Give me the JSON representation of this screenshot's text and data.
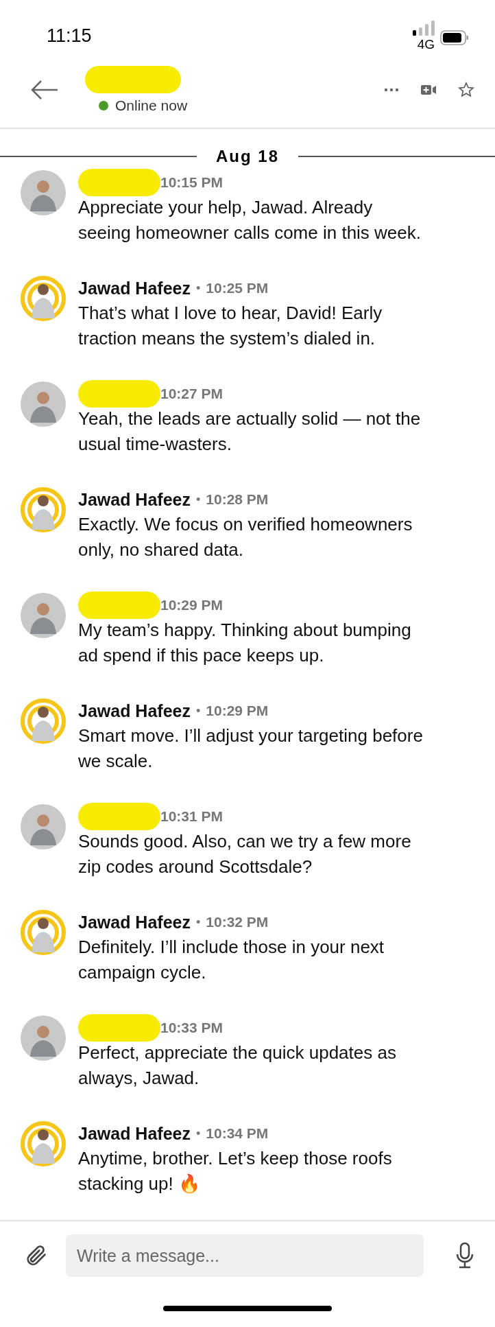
{
  "status_bar": {
    "time": "11:15",
    "network": "4G"
  },
  "header": {
    "title_redacted": true,
    "presence": "Online now",
    "online": true
  },
  "date_divider": "Aug 18",
  "messages": [
    {
      "kind": "contact",
      "redacted": true,
      "time": "10:15 PM",
      "text": "Appreciate your help, Jawad. Already seeing homeowner calls come in this week."
    },
    {
      "kind": "self",
      "name": "Jawad Hafeez",
      "separator": "•",
      "time": "10:25 PM",
      "text": "That’s what I love to hear, David! Early traction means the system’s dialed in."
    },
    {
      "kind": "contact",
      "redacted": true,
      "time": "10:27 PM",
      "text": "Yeah, the leads are actually solid — not the usual time-wasters."
    },
    {
      "kind": "self",
      "name": "Jawad Hafeez",
      "separator": "•",
      "time": "10:28 PM",
      "text": "Exactly. We focus on verified homeowners only, no shared data."
    },
    {
      "kind": "contact",
      "redacted": true,
      "time": "10:29 PM",
      "text": "My team’s happy. Thinking about bumping ad spend if this pace keeps up."
    },
    {
      "kind": "self",
      "name": "Jawad Hafeez",
      "separator": "•",
      "time": "10:29 PM",
      "text": "Smart move. I’ll adjust your targeting before we scale."
    },
    {
      "kind": "contact",
      "redacted": true,
      "time": "10:31 PM",
      "text": "Sounds good. Also, can we try a few more zip codes around Scottsdale?"
    },
    {
      "kind": "self",
      "name": "Jawad Hafeez",
      "separator": "•",
      "time": "10:32 PM",
      "text": "Definitely. I’ll include those in your next campaign cycle."
    },
    {
      "kind": "contact",
      "redacted": true,
      "time": "10:33 PM",
      "text": "Perfect, appreciate the quick updates as always, Jawad."
    },
    {
      "kind": "self",
      "name": "Jawad Hafeez",
      "separator": "•",
      "time": "10:34 PM",
      "text": "Anytime, brother. Let’s keep those roofs stacking up! 🔥"
    }
  ],
  "composer": {
    "placeholder": "Write a message..."
  }
}
